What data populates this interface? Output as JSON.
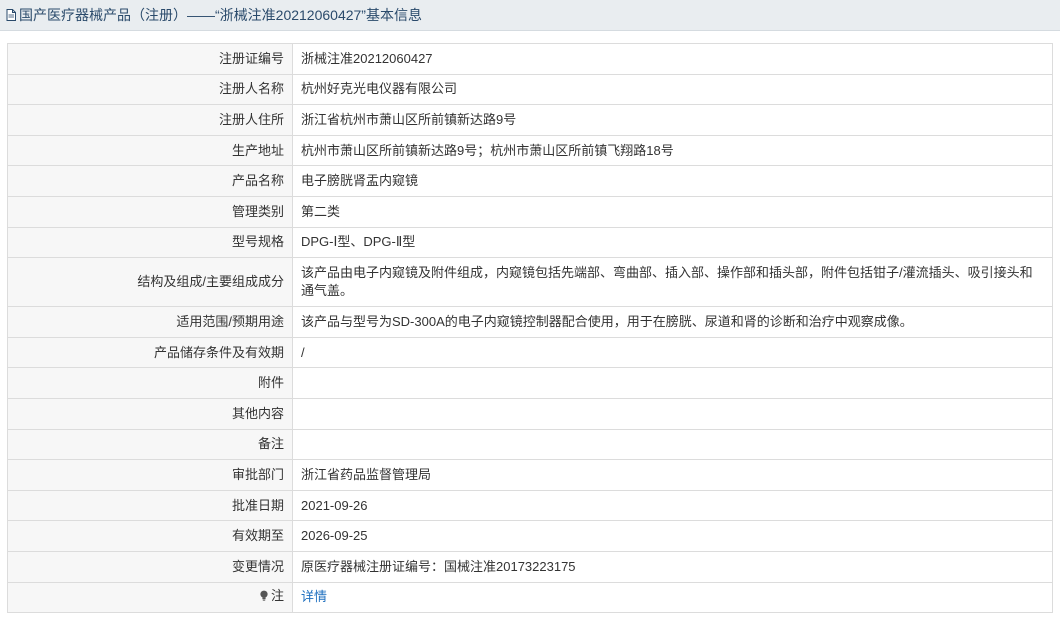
{
  "header": {
    "title": "国产医疗器械产品（注册）——“浙械注准20212060427”基本信息"
  },
  "fields": [
    {
      "label": "注册证编号",
      "value": "浙械注准20212060427"
    },
    {
      "label": "注册人名称",
      "value": "杭州好克光电仪器有限公司"
    },
    {
      "label": "注册人住所",
      "value": "浙江省杭州市萧山区所前镇新达路9号"
    },
    {
      "label": "生产地址",
      "value": "杭州市萧山区所前镇新达路9号；杭州市萧山区所前镇飞翔路18号"
    },
    {
      "label": "产品名称",
      "value": "电子膀胱肾盂内窥镜"
    },
    {
      "label": "管理类别",
      "value": "第二类"
    },
    {
      "label": "型号规格",
      "value": "DPG-Ⅰ型、DPG-Ⅱ型"
    },
    {
      "label": "结构及组成/主要组成成分",
      "value": "该产品由电子内窥镜及附件组成，内窥镜包括先端部、弯曲部、插入部、操作部和插头部，附件包括钳子/灌流插头、吸引接头和通气盖。"
    },
    {
      "label": "适用范围/预期用途",
      "value": "该产品与型号为SD-300A的电子内窥镜控制器配合使用，用于在膀胱、尿道和肾的诊断和治疗中观察成像。"
    },
    {
      "label": "产品储存条件及有效期",
      "value": "/"
    },
    {
      "label": "附件",
      "value": ""
    },
    {
      "label": "其他内容",
      "value": ""
    },
    {
      "label": "备注",
      "value": ""
    },
    {
      "label": "审批部门",
      "value": "浙江省药品监督管理局"
    },
    {
      "label": "批准日期",
      "value": "2021-09-26"
    },
    {
      "label": "有效期至",
      "value": "2026-09-25"
    },
    {
      "label": "变更情况",
      "value": "原医疗器械注册证编号：国械注准20173223175"
    }
  ],
  "note": {
    "label": "注",
    "icon": "lightbulb-icon",
    "link_text": "详情"
  },
  "colors": {
    "header_bg": "#e9edf0",
    "label_bg": "#f7f7f7",
    "border": "#dcdcdc",
    "link": "#1e6fbf"
  }
}
